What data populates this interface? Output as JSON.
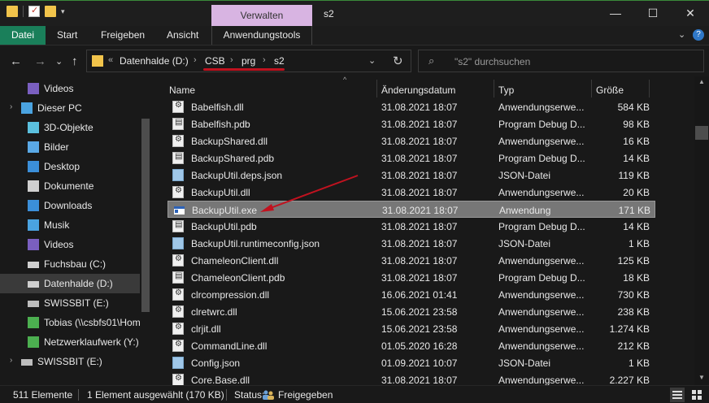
{
  "window": {
    "title": "s2",
    "context_group": "Verwalten",
    "controls": {
      "minimize": "—",
      "maximize": "☐",
      "close": "✕"
    }
  },
  "ribbon": {
    "tabs": [
      "Datei",
      "Start",
      "Freigeben",
      "Ansicht",
      "Anwendungstools"
    ],
    "active_tab": "Datei",
    "collapse_glyph": "⌄",
    "help_glyph": "?"
  },
  "nav": {
    "back": "←",
    "forward": "→",
    "recent": "⌄",
    "up": "↑",
    "overflow": "«",
    "breadcrumb": [
      "Datenhalde (D:)",
      "CSB",
      "prg",
      "s2"
    ],
    "crumb_sep": "›",
    "dropdown": "⌄",
    "refresh": "↻"
  },
  "search": {
    "placeholder": "\"s2\" durchsuchen",
    "icon": "⌕"
  },
  "sidebar": {
    "items": [
      {
        "label": "Videos",
        "icon": "videos-icon",
        "indent": 2
      },
      {
        "label": "Dieser PC",
        "icon": "pc-icon",
        "indent": 1,
        "expander": "›"
      },
      {
        "label": "3D-Objekte",
        "icon": "3d-objects-icon",
        "indent": 2
      },
      {
        "label": "Bilder",
        "icon": "pictures-icon",
        "indent": 2
      },
      {
        "label": "Desktop",
        "icon": "desktop-icon",
        "indent": 2
      },
      {
        "label": "Dokumente",
        "icon": "documents-icon",
        "indent": 2
      },
      {
        "label": "Downloads",
        "icon": "downloads-icon",
        "indent": 2
      },
      {
        "label": "Musik",
        "icon": "music-icon",
        "indent": 2
      },
      {
        "label": "Videos",
        "icon": "videos-icon",
        "indent": 2
      },
      {
        "label": "Fuchsbau (C:)",
        "icon": "drive-icon",
        "indent": 2
      },
      {
        "label": "Datenhalde (D:)",
        "icon": "drive-icon",
        "indent": 2,
        "active": true
      },
      {
        "label": "SWISSBIT (E:)",
        "icon": "usb-drive-icon",
        "indent": 2
      },
      {
        "label": "Tobias (\\\\csbfs01\\Hom",
        "icon": "network-drive-icon",
        "indent": 2
      },
      {
        "label": "Netzwerklaufwerk (Y:)",
        "icon": "network-drive-icon",
        "indent": 2
      },
      {
        "label": "SWISSBIT (E:)",
        "icon": "usb-drive-icon",
        "indent": 1,
        "expander": "›"
      }
    ]
  },
  "columns": {
    "name": "Name",
    "date": "Änderungsdatum",
    "type": "Typ",
    "size": "Größe",
    "sort_glyph": "^"
  },
  "files": [
    {
      "name": "Babelfish.dll",
      "date": "31.08.2021 18:07",
      "type": "Anwendungserwe...",
      "size": "584 KB",
      "icon": "dll"
    },
    {
      "name": "Babelfish.pdb",
      "date": "31.08.2021 18:07",
      "type": "Program Debug D...",
      "size": "98 KB",
      "icon": "pdb"
    },
    {
      "name": "BackupShared.dll",
      "date": "31.08.2021 18:07",
      "type": "Anwendungserwe...",
      "size": "16 KB",
      "icon": "dll"
    },
    {
      "name": "BackupShared.pdb",
      "date": "31.08.2021 18:07",
      "type": "Program Debug D...",
      "size": "14 KB",
      "icon": "pdb"
    },
    {
      "name": "BackupUtil.deps.json",
      "date": "31.08.2021 18:07",
      "type": "JSON-Datei",
      "size": "119 KB",
      "icon": "json"
    },
    {
      "name": "BackupUtil.dll",
      "date": "31.08.2021 18:07",
      "type": "Anwendungserwe...",
      "size": "20 KB",
      "icon": "dll"
    },
    {
      "name": "BackupUtil.exe",
      "date": "31.08.2021 18:07",
      "type": "Anwendung",
      "size": "171 KB",
      "icon": "exe",
      "selected": true
    },
    {
      "name": "BackupUtil.pdb",
      "date": "31.08.2021 18:07",
      "type": "Program Debug D...",
      "size": "14 KB",
      "icon": "pdb"
    },
    {
      "name": "BackupUtil.runtimeconfig.json",
      "date": "31.08.2021 18:07",
      "type": "JSON-Datei",
      "size": "1 KB",
      "icon": "json"
    },
    {
      "name": "ChameleonClient.dll",
      "date": "31.08.2021 18:07",
      "type": "Anwendungserwe...",
      "size": "125 KB",
      "icon": "dll"
    },
    {
      "name": "ChameleonClient.pdb",
      "date": "31.08.2021 18:07",
      "type": "Program Debug D...",
      "size": "18 KB",
      "icon": "pdb"
    },
    {
      "name": "clrcompression.dll",
      "date": "16.06.2021 01:41",
      "type": "Anwendungserwe...",
      "size": "730 KB",
      "icon": "dll"
    },
    {
      "name": "clretwrc.dll",
      "date": "15.06.2021 23:58",
      "type": "Anwendungserwe...",
      "size": "238 KB",
      "icon": "dll"
    },
    {
      "name": "clrjit.dll",
      "date": "15.06.2021 23:58",
      "type": "Anwendungserwe...",
      "size": "1.274 KB",
      "icon": "dll"
    },
    {
      "name": "CommandLine.dll",
      "date": "01.05.2020 16:28",
      "type": "Anwendungserwe...",
      "size": "212 KB",
      "icon": "dll"
    },
    {
      "name": "Config.json",
      "date": "01.09.2021 10:07",
      "type": "JSON-Datei",
      "size": "1 KB",
      "icon": "json"
    },
    {
      "name": "Core.Base.dll",
      "date": "31.08.2021 18:07",
      "type": "Anwendungserwe...",
      "size": "2.227 KB",
      "icon": "dll"
    }
  ],
  "status": {
    "count": "511 Elemente",
    "selection": "1 Element ausgewählt (170 KB)",
    "status_label": "Status:",
    "share": "Freigegeben"
  },
  "colors": {
    "accent": "#1a7f5a",
    "context_tab": "#d8b4e2",
    "annotation": "#c1121f",
    "selected_row": "#777777"
  }
}
